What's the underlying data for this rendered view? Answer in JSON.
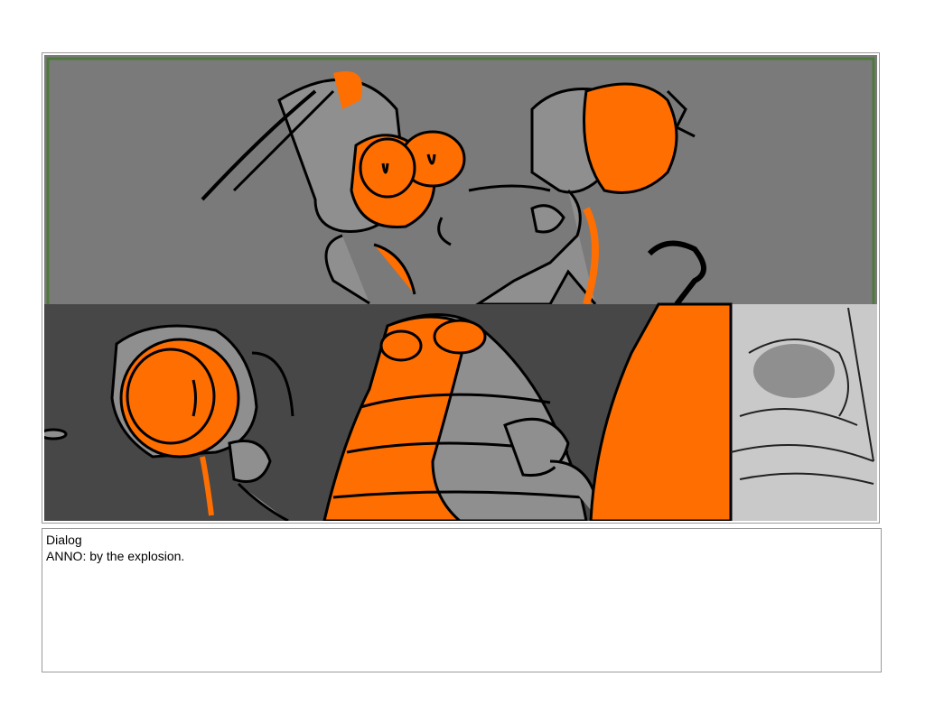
{
  "storyboard": {
    "panel": {
      "image_description_icon": "storyboard-sketch-illustration",
      "colors": {
        "upper_bg": "#7a7a7a",
        "lower_bg": "#474747",
        "right_bg": "#c9c9c9",
        "accent_orange": "#ff6e00",
        "grey_fill": "#8f8f8f",
        "frame_green": "#4d7a3c",
        "line": "#000000"
      }
    },
    "dialog": {
      "heading": "Dialog",
      "text": "ANNO: by the explosion."
    }
  }
}
